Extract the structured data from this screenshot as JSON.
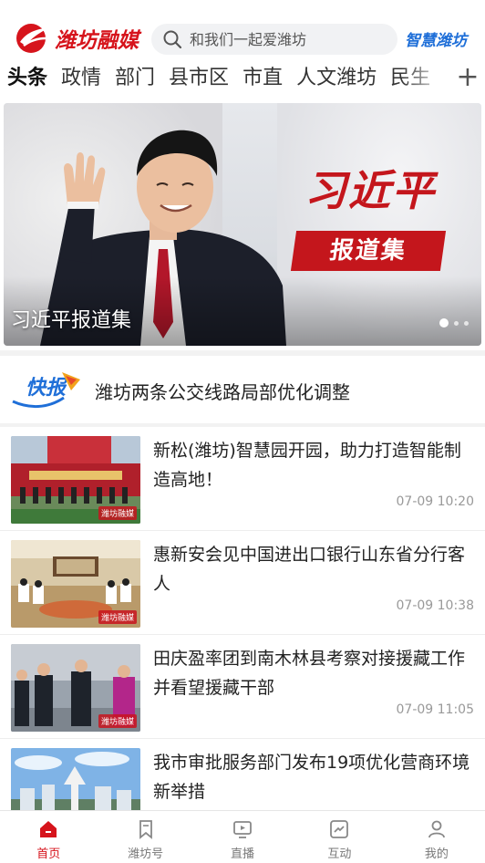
{
  "header": {
    "logo_text": "潍坊融媒",
    "search_placeholder": "和我们一起爱潍坊",
    "smart_link": "智慧潍坊"
  },
  "tabs": [
    {
      "label": "头条",
      "active": true
    },
    {
      "label": "政情"
    },
    {
      "label": "部门"
    },
    {
      "label": "县市区"
    },
    {
      "label": "市直"
    },
    {
      "label": "人文潍坊"
    },
    {
      "label": "民生"
    }
  ],
  "plus_label": "+",
  "banner": {
    "title": "习近平",
    "subtitle": "报道集",
    "caption": "习近平报道集",
    "dots": 3,
    "active_dot": 1
  },
  "express": {
    "logo_text": "快报",
    "headline": "潍坊两条公交线路局部优化调整"
  },
  "news": [
    {
      "title": "新松(潍坊)智慧园开园，助力打造智能制造高地！",
      "time": "07-09 10:20",
      "thumb": "ceremony",
      "watermark": "潍坊融媒"
    },
    {
      "title": "惠新安会见中国进出口银行山东省分行客人",
      "time": "07-09 10:38",
      "thumb": "meeting",
      "watermark": "潍坊融媒"
    },
    {
      "title": "田庆盈率团到南木林县考察对接援藏工作并看望援藏干部",
      "time": "07-09 11:05",
      "thumb": "handshake",
      "watermark": "潍坊融媒"
    },
    {
      "title": "我市审批服务部门发布19项优化营商环境新举措",
      "time": "",
      "thumb": "city",
      "watermark": ""
    }
  ],
  "bottom_nav": [
    {
      "label": "首页",
      "icon": "home-icon",
      "active": true
    },
    {
      "label": "潍坊号",
      "icon": "bookmark-icon"
    },
    {
      "label": "直播",
      "icon": "tv-icon"
    },
    {
      "label": "互动",
      "icon": "interact-icon"
    },
    {
      "label": "我的",
      "icon": "user-icon"
    }
  ],
  "colors": {
    "brand_red": "#d6141c",
    "smart_blue": "#1f6fd8"
  }
}
